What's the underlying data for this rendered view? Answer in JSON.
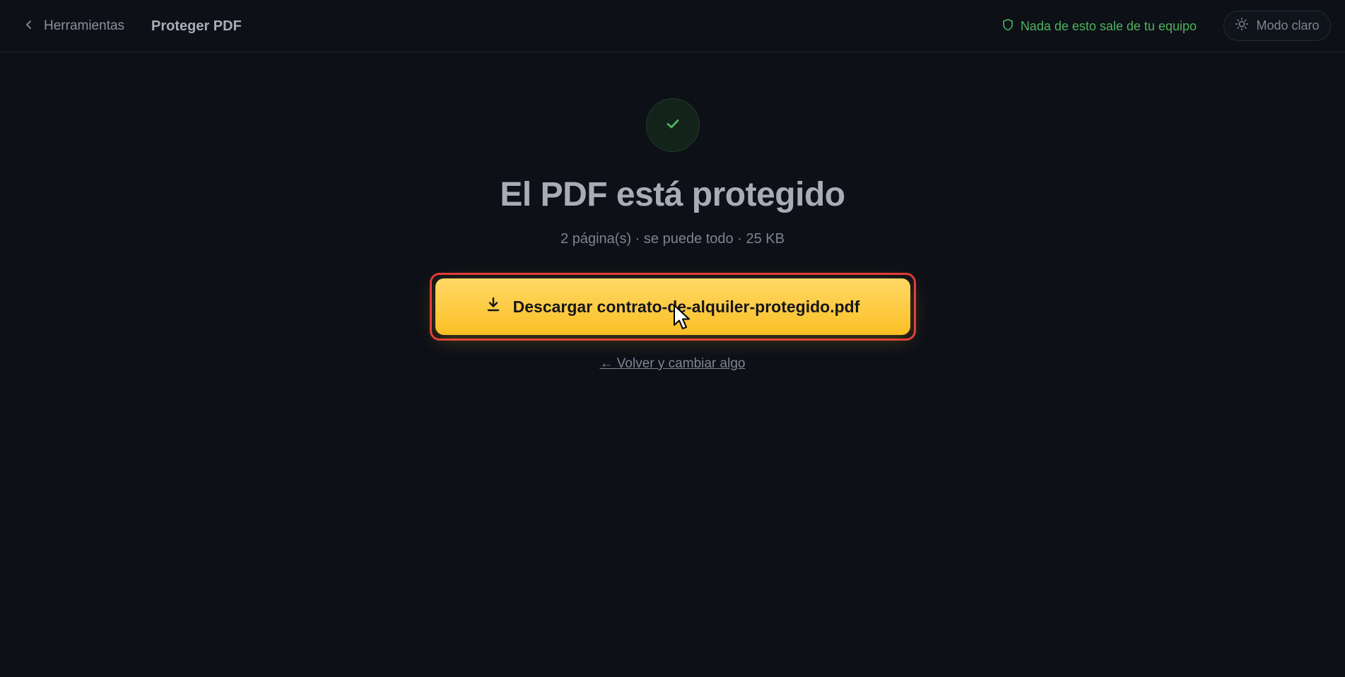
{
  "header": {
    "back_label": "Herramientas",
    "title": "Proteger PDF",
    "privacy_text": "Nada de esto sale de tu equipo",
    "theme_toggle_label": "Modo claro"
  },
  "result": {
    "heading": "El PDF está protegido",
    "meta": "2 página(s) · se puede todo · 25 KB",
    "download_label": "Descargar contrato-de-alquiler-protegido.pdf",
    "back_change_label": "← Volver y cambiar algo"
  },
  "icons": {
    "back": "chevron-left-icon",
    "privacy": "shield-icon",
    "theme": "sun-icon",
    "success": "check-icon",
    "download": "download-icon"
  },
  "colors": {
    "background": "#0d1017",
    "accent": "#fbbf24",
    "success": "#4fb35f",
    "highlight": "#e0393a"
  }
}
